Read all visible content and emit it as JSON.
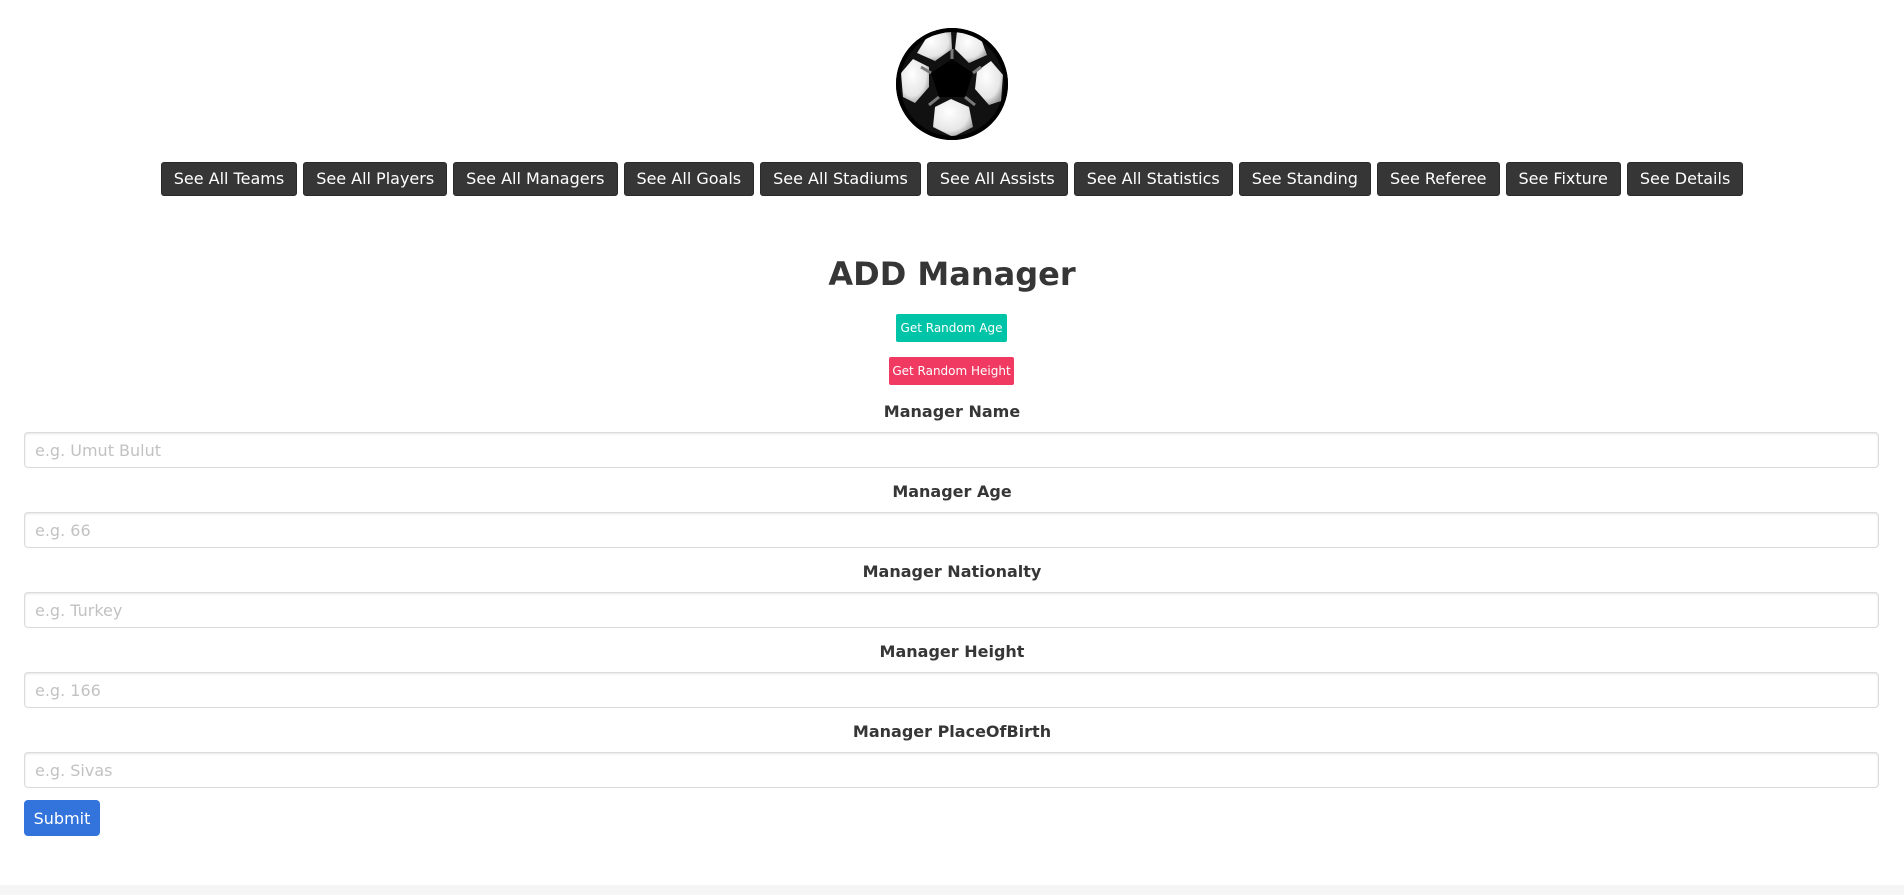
{
  "logo": {
    "icon": "soccer-ball-icon"
  },
  "nav": {
    "items": [
      {
        "label": "See All Teams"
      },
      {
        "label": "See All Players"
      },
      {
        "label": "See All Managers"
      },
      {
        "label": "See All Goals"
      },
      {
        "label": "See All Stadiums"
      },
      {
        "label": "See All Assists"
      },
      {
        "label": "See All Statistics"
      },
      {
        "label": "See Standing"
      },
      {
        "label": "See Referee"
      },
      {
        "label": "See Fixture"
      },
      {
        "label": "See Details"
      }
    ]
  },
  "form": {
    "title": "ADD Manager",
    "random_age_label": "Get Random Age",
    "random_height_label": "Get Random Height",
    "fields": [
      {
        "label": "Manager Name",
        "placeholder": "e.g. Umut Bulut",
        "value": ""
      },
      {
        "label": "Manager Age",
        "placeholder": "e.g. 66",
        "value": ""
      },
      {
        "label": "Manager Nationalty",
        "placeholder": "e.g. Turkey",
        "value": ""
      },
      {
        "label": "Manager Height",
        "placeholder": "e.g. 166",
        "value": ""
      },
      {
        "label": "Manager PlaceOfBirth",
        "placeholder": "e.g. Sivas",
        "value": ""
      }
    ],
    "submit_label": "Submit"
  },
  "colors": {
    "nav_button": "#363636",
    "random_age": "#00c4a7",
    "random_height": "#f03a62",
    "submit": "#3273dc"
  }
}
